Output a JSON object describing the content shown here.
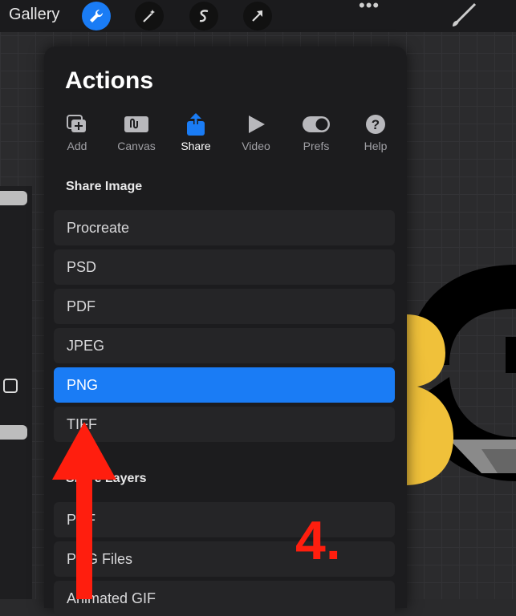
{
  "topbar": {
    "gallery_label": "Gallery",
    "tools": [
      "wrench-icon",
      "magic-wand-icon",
      "selection-s-icon",
      "transform-arrow-icon"
    ],
    "more_label": "•••",
    "accent": "#1a7cf5"
  },
  "actions": {
    "title": "Actions",
    "tabs": [
      {
        "label": "Add",
        "icon": "add-icon"
      },
      {
        "label": "Canvas",
        "icon": "canvas-icon"
      },
      {
        "label": "Share",
        "icon": "share-icon",
        "active": true
      },
      {
        "label": "Video",
        "icon": "video-play-icon"
      },
      {
        "label": "Prefs",
        "icon": "prefs-toggle-icon"
      },
      {
        "label": "Help",
        "icon": "help-icon"
      }
    ],
    "share_image": {
      "heading": "Share Image",
      "items": [
        "Procreate",
        "PSD",
        "PDF",
        "JPEG",
        "PNG",
        "TIFF"
      ],
      "selected": "PNG"
    },
    "share_layers": {
      "heading": "Share Layers",
      "items": [
        "PDF",
        "PNG Files",
        "Animated GIF"
      ]
    }
  },
  "annotation": {
    "step_label": "4.",
    "color": "#ff1e0e"
  }
}
